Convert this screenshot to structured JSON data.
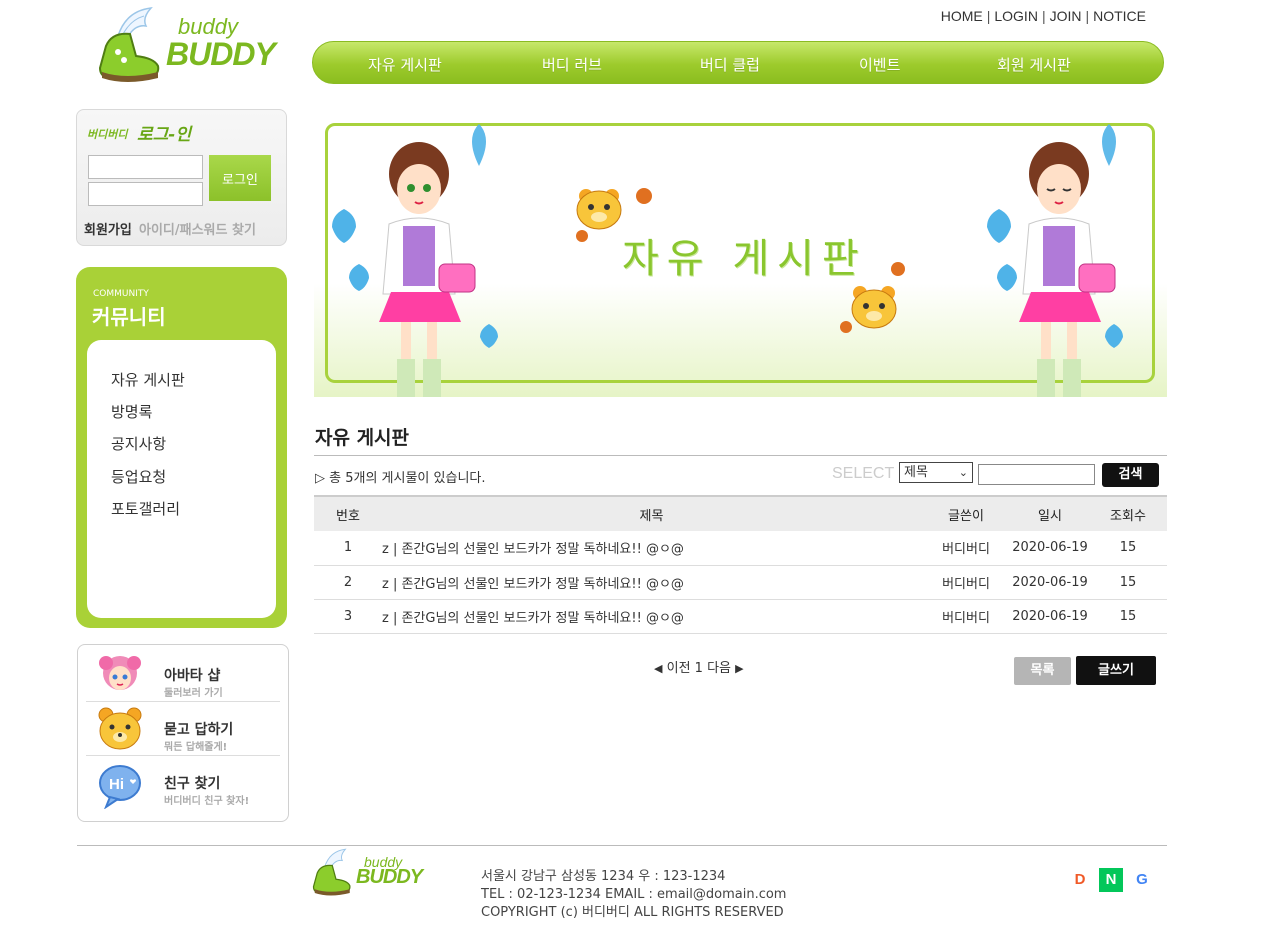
{
  "brand": {
    "top": "buddy",
    "bottom": "BUDDY"
  },
  "topnav": {
    "home": "HOME",
    "login": "LOGIN",
    "join": "JOIN",
    "notice": "NOTICE",
    "sep": "|"
  },
  "mainnav": [
    {
      "label": "자유 게시판"
    },
    {
      "label": "버디 러브"
    },
    {
      "label": "버디 클럽"
    },
    {
      "label": "이벤트"
    },
    {
      "label": "회원 게시판"
    }
  ],
  "login": {
    "title_small": "버디버디",
    "title_large": "로그-인",
    "button": "로그인",
    "join": "회원가입",
    "find": "아이디/패스워드 찾기"
  },
  "community": {
    "en": "COMMUNITY",
    "ko": "커뮤니티",
    "items": [
      {
        "label": "자유 게시판"
      },
      {
        "label": "방명록"
      },
      {
        "label": "공지사항"
      },
      {
        "label": "등업요청"
      },
      {
        "label": "포토갤러리"
      }
    ]
  },
  "quick": [
    {
      "title": "아바타 샵",
      "sub": "둘러보러 가기"
    },
    {
      "title": "묻고 답하기",
      "sub": "뭐든 답해줄게!"
    },
    {
      "title": "친구 찾기",
      "sub": "버디버디 친구 찾자!"
    }
  ],
  "banner": {
    "title": "자유 게시판"
  },
  "board": {
    "title": "자유 게시판",
    "count_text": "▷ 총 5개의 게시물이 있습니다.",
    "select_label": "SELECT",
    "select_value": "제목",
    "search_button": "검색",
    "columns": {
      "num": "번호",
      "title": "제목",
      "author": "글쓴이",
      "date": "일시",
      "views": "조회수"
    },
    "rows": [
      {
        "num": "1",
        "title": "z | 존간G님의 선물인 보드카가 정말 독하네요!! @ㅇ@",
        "author": "버디버디",
        "date": "2020-06-19",
        "views": "15"
      },
      {
        "num": "2",
        "title": "z | 존간G님의 선물인 보드카가 정말 독하네요!! @ㅇ@",
        "author": "버디버디",
        "date": "2020-06-19",
        "views": "15"
      },
      {
        "num": "3",
        "title": "z | 존간G님의 선물인 보드카가 정말 독하네요!! @ㅇ@",
        "author": "버디버디",
        "date": "2020-06-19",
        "views": "15"
      }
    ],
    "pager": {
      "prev_arrow": "◀",
      "prev": "이전",
      "page": "1",
      "next": "다음",
      "next_arrow": "▶"
    },
    "list_button": "목록",
    "write_button": "글쓰기"
  },
  "footer": {
    "address": "서울시 강남구 삼성동 1234 우 : 123-1234",
    "contact": "TEL : 02-123-1234 EMAIL : email@domain.com",
    "copyright": "COPYRIGHT (c) 버디버디 ALL RIGHTS RESERVED",
    "social": [
      {
        "letter": "D",
        "color": "#f05a28"
      },
      {
        "letter": "N",
        "color": "#03c75a"
      },
      {
        "letter": "G",
        "color": "#4285f4"
      }
    ]
  }
}
